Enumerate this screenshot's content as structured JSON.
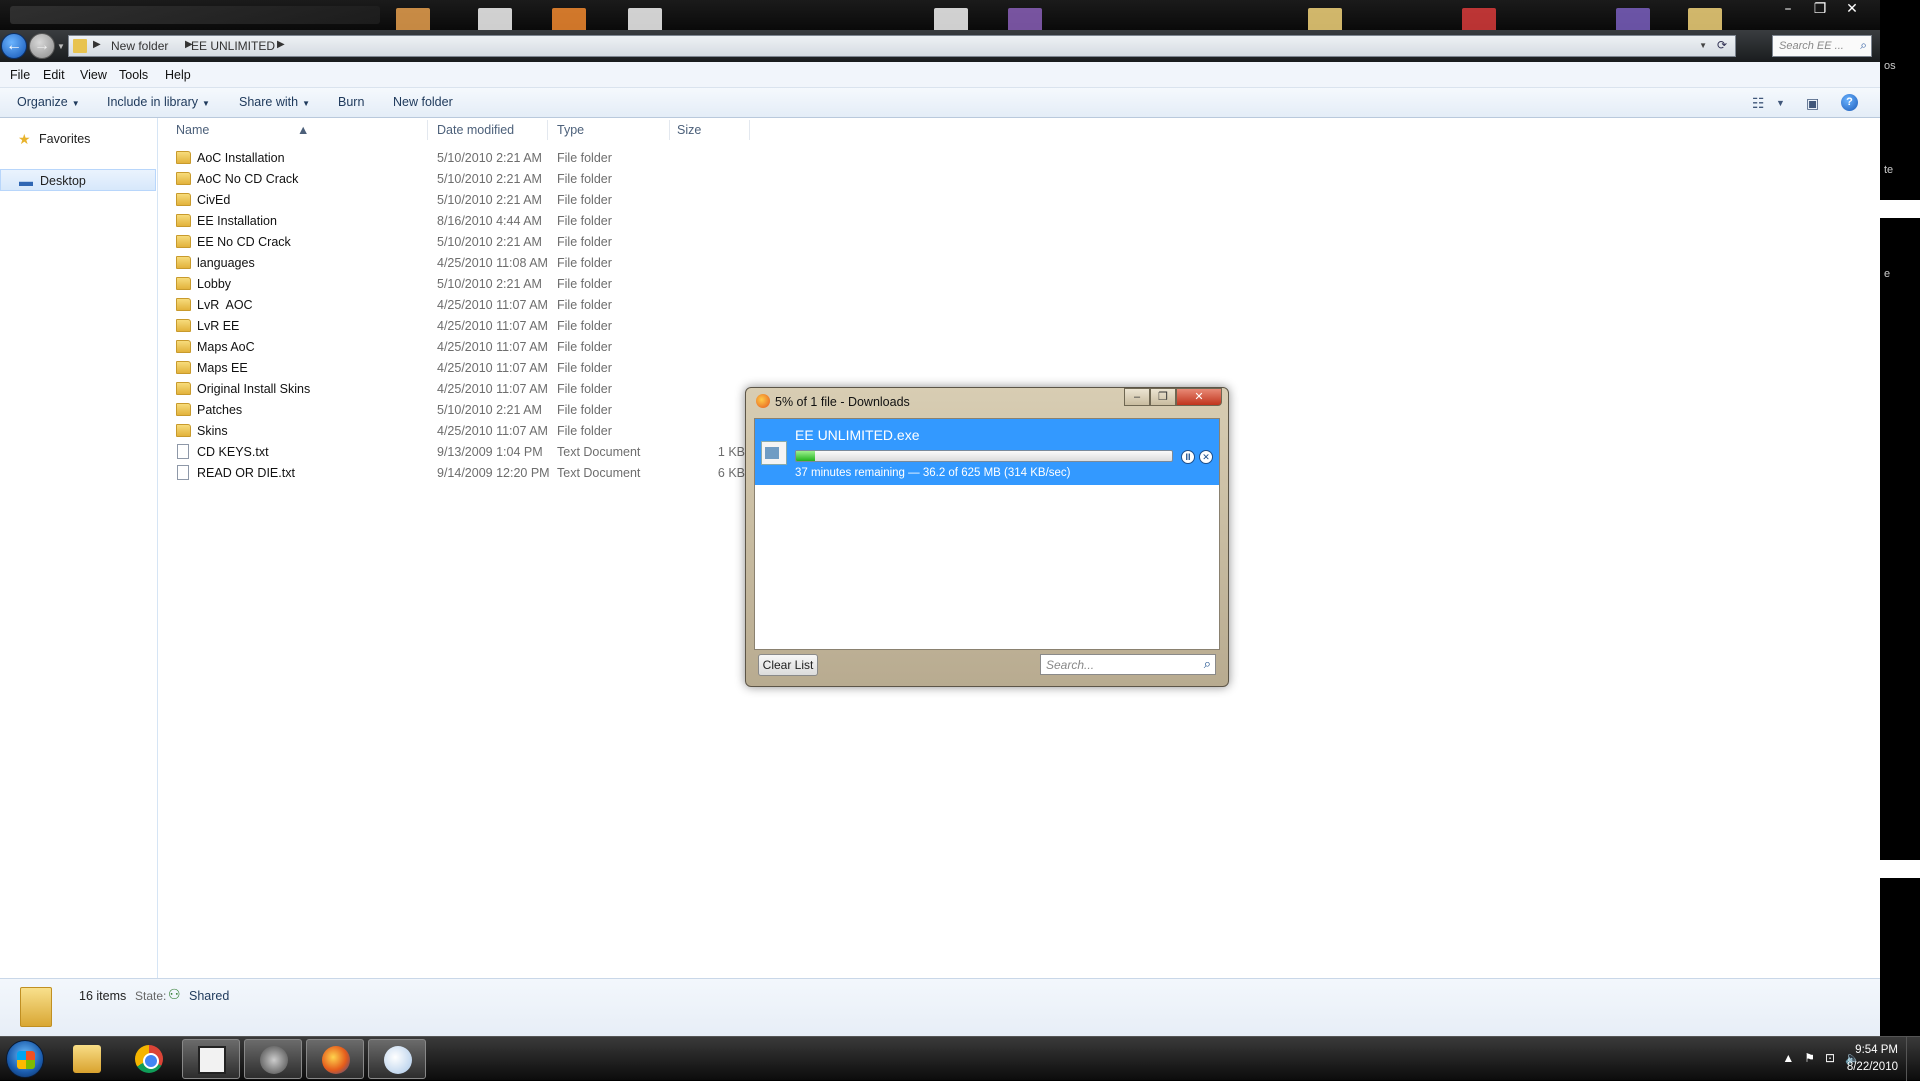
{
  "window": {
    "breadcrumb": [
      "New folder",
      "EE UNLIMITED"
    ],
    "search_placeholder": "Search EE ..."
  },
  "menubar": [
    "File",
    "Edit",
    "View",
    "Tools",
    "Help"
  ],
  "commandbar": {
    "organize": "Organize",
    "include_in_library": "Include in library",
    "share_with": "Share with",
    "burn": "Burn",
    "new_folder": "New folder"
  },
  "navpane": {
    "favorites": "Favorites",
    "desktop": "Desktop"
  },
  "columns": {
    "name": "Name",
    "date": "Date modified",
    "type": "Type",
    "size": "Size"
  },
  "files": [
    {
      "name": "AoC Installation",
      "date": "5/10/2010 2:21 AM",
      "type": "File folder",
      "size": "",
      "kind": "folder"
    },
    {
      "name": "AoC No CD Crack",
      "date": "5/10/2010 2:21 AM",
      "type": "File folder",
      "size": "",
      "kind": "folder"
    },
    {
      "name": "CivEd",
      "date": "5/10/2010 2:21 AM",
      "type": "File folder",
      "size": "",
      "kind": "folder"
    },
    {
      "name": "EE Installation",
      "date": "8/16/2010 4:44 AM",
      "type": "File folder",
      "size": "",
      "kind": "folder"
    },
    {
      "name": "EE No CD Crack",
      "date": "5/10/2010 2:21 AM",
      "type": "File folder",
      "size": "",
      "kind": "folder"
    },
    {
      "name": "languages",
      "date": "4/25/2010 11:08 AM",
      "type": "File folder",
      "size": "",
      "kind": "folder"
    },
    {
      "name": "Lobby",
      "date": "5/10/2010 2:21 AM",
      "type": "File folder",
      "size": "",
      "kind": "folder"
    },
    {
      "name": "LvR  AOC",
      "date": "4/25/2010 11:07 AM",
      "type": "File folder",
      "size": "",
      "kind": "folder"
    },
    {
      "name": "LvR EE",
      "date": "4/25/2010 11:07 AM",
      "type": "File folder",
      "size": "",
      "kind": "folder"
    },
    {
      "name": "Maps AoC",
      "date": "4/25/2010 11:07 AM",
      "type": "File folder",
      "size": "",
      "kind": "folder"
    },
    {
      "name": "Maps EE",
      "date": "4/25/2010 11:07 AM",
      "type": "File folder",
      "size": "",
      "kind": "folder"
    },
    {
      "name": "Original Install Skins",
      "date": "4/25/2010 11:07 AM",
      "type": "File folder",
      "size": "",
      "kind": "folder"
    },
    {
      "name": "Patches",
      "date": "5/10/2010 2:21 AM",
      "type": "File folder",
      "size": "",
      "kind": "folder"
    },
    {
      "name": "Skins",
      "date": "4/25/2010 11:07 AM",
      "type": "File folder",
      "size": "",
      "kind": "folder"
    },
    {
      "name": "CD KEYS.txt",
      "date": "9/13/2009 1:04 PM",
      "type": "Text Document",
      "size": "1 KB",
      "kind": "doc"
    },
    {
      "name": "READ OR DIE.txt",
      "date": "9/14/2009 12:20 PM",
      "type": "Text Document",
      "size": "6 KB",
      "kind": "doc"
    }
  ],
  "details": {
    "count": "16 items",
    "state_label": "State:",
    "state_value": "Shared"
  },
  "downloads": {
    "title": "5% of 1 file - Downloads",
    "file_name": "EE UNLIMITED.exe",
    "progress_percent": 5,
    "status": "37 minutes remaining — 36.2 of 625 MB (314 KB/sec)",
    "clear_button": "Clear List",
    "search_placeholder": "Search..."
  },
  "right_fragments": [
    "os",
    "te",
    "e"
  ],
  "clock": {
    "time": "9:54 PM",
    "date": "8/22/2010"
  },
  "colors": {
    "selection_blue": "#3399ff",
    "progress_green": "#22b31c"
  }
}
